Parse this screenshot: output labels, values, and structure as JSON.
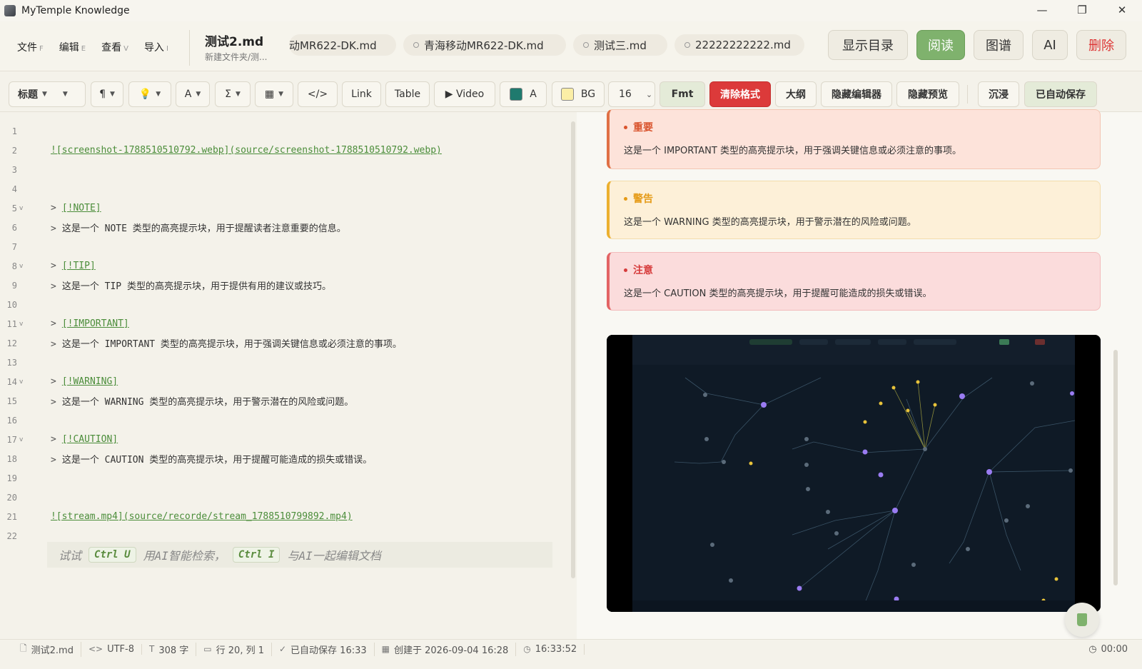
{
  "window": {
    "title": "MyTemple Knowledge",
    "minimize": "—",
    "maximize": "❐",
    "close": "✕"
  },
  "menu": [
    {
      "label": "文件",
      "acc": "F"
    },
    {
      "label": "编辑",
      "acc": "E"
    },
    {
      "label": "查看",
      "acc": "V"
    },
    {
      "label": "导入",
      "acc": "I"
    }
  ],
  "doc": {
    "name": "测试2.md",
    "path": "新建文件夹/测..."
  },
  "tabs": [
    "动MR622-DK.md",
    "青海移动MR622-DK.md",
    "测试三.md",
    "22222222222.md"
  ],
  "view_buttons": {
    "toc": "显示目录",
    "read": "阅读",
    "graph": "图谱",
    "ai": "AI",
    "delete": "删除"
  },
  "toolbar": {
    "heading": "标题",
    "paragraph": "¶",
    "bulb": "💡",
    "font": "A",
    "sigma": "Σ",
    "table_icon": "▦",
    "code": "</>",
    "link": "Link",
    "table": "Table",
    "video": "▶ Video",
    "color_a": "A",
    "bg": "BG",
    "size": "16",
    "fmt": "Fmt",
    "clear": "清除格式",
    "outline": "大纲",
    "hide_editor": "隐藏编辑器",
    "hide_preview": "隐藏预览",
    "immersive": "沉浸",
    "autosave": "已自动保存",
    "text_color": "#1f7a6e",
    "bg_color": "#fbeea6"
  },
  "editor": {
    "lines": [
      {
        "n": "1",
        "text": ""
      },
      {
        "n": "2",
        "link": "![screenshot-1788510510792.webp](source/screenshot-1788510510792.webp)"
      },
      {
        "n": "3",
        "text": ""
      },
      {
        "n": "4",
        "text": ""
      },
      {
        "n": "5",
        "fold": "v",
        "q": ">",
        "link": "[!NOTE]"
      },
      {
        "n": "6",
        "q": ">",
        "text": "这是一个 NOTE 类型的高亮提示块，用于提醒读者注意重要的信息。"
      },
      {
        "n": "7",
        "text": ""
      },
      {
        "n": "8",
        "fold": "v",
        "q": ">",
        "link": "[!TIP]"
      },
      {
        "n": "9",
        "q": ">",
        "text": "这是一个 TIP 类型的高亮提示块，用于提供有用的建议或技巧。"
      },
      {
        "n": "10",
        "text": ""
      },
      {
        "n": "11",
        "fold": "v",
        "q": ">",
        "link": "[!IMPORTANT]"
      },
      {
        "n": "12",
        "q": ">",
        "text": "这是一个 IMPORTANT 类型的高亮提示块，用于强调关键信息或必须注意的事项。"
      },
      {
        "n": "13",
        "text": ""
      },
      {
        "n": "14",
        "fold": "v",
        "q": ">",
        "link": "[!WARNING]"
      },
      {
        "n": "15",
        "q": ">",
        "text": "这是一个 WARNING 类型的高亮提示块，用于警示潜在的风险或问题。"
      },
      {
        "n": "16",
        "text": ""
      },
      {
        "n": "17",
        "fold": "v",
        "q": ">",
        "link": "[!CAUTION]"
      },
      {
        "n": "18",
        "q": ">",
        "text": "这是一个 CAUTION 类型的高亮提示块，用于提醒可能造成的损失或错误。"
      },
      {
        "n": "19",
        "text": ""
      },
      {
        "n": "20",
        "text": ""
      },
      {
        "n": "21",
        "link": "![stream.mp4](source/recorde/stream_1788510799892.mp4)"
      },
      {
        "n": "22",
        "text": ""
      }
    ],
    "hint": {
      "try": "试试",
      "k1": "Ctrl U",
      "mid": "用AI智能检索，",
      "k2": "Ctrl I",
      "end": "与AI一起编辑文档"
    }
  },
  "preview": {
    "important": {
      "title": "重要",
      "text": "这是一个 IMPORTANT 类型的高亮提示块，用于强调关键信息或必须注意的事项。"
    },
    "warning": {
      "title": "警告",
      "text": "这是一个 WARNING 类型的高亮提示块，用于警示潜在的风险或问题。"
    },
    "caution": {
      "title": "注意",
      "text": "这是一个 CAUTION 类型的高亮提示块，用于提醒可能造成的损失或错误。"
    }
  },
  "status": {
    "file": "测试2.md",
    "encoding": "UTF-8",
    "chars": "308 字",
    "position": "行 20, 列 1",
    "saved": "已自动保存 16:33",
    "created": "创建于 2026-09-04 16:28",
    "clock": "16:33:52",
    "timer": "00:00"
  }
}
